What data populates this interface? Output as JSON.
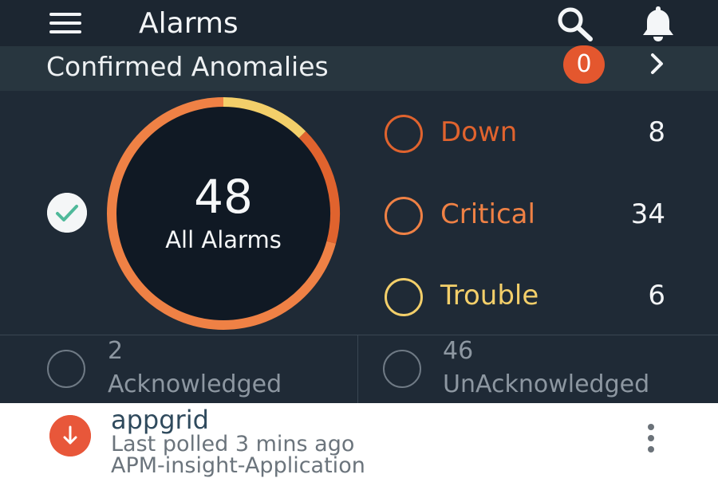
{
  "appbar": {
    "title": "Alarms",
    "menu_icon": "hamburger-menu-icon",
    "search_icon": "search-icon",
    "bell_icon": "bell-icon"
  },
  "anomalies": {
    "label": "Confirmed Anomalies",
    "count": "0",
    "chevron_icon": "chevron-right-icon"
  },
  "summary": {
    "total": "48",
    "total_label": "All Alarms",
    "selected_icon": "check-icon",
    "severities": [
      {
        "label": "Down",
        "count": "8",
        "color": "#e0632e"
      },
      {
        "label": "Critical",
        "count": "34",
        "color": "#ef8145"
      },
      {
        "label": "Trouble",
        "count": "6",
        "color": "#f3cf6a"
      }
    ]
  },
  "ack": {
    "acknowledged_count": "2",
    "acknowledged_label": "Acknowledged",
    "unacknowledged_count": "46",
    "unacknowledged_label": "UnAcknowledged"
  },
  "alarms": [
    {
      "name": "appgrid",
      "polled": "Last polled 3 mins ago",
      "type": "APM-insight-Application",
      "status_icon": "arrow-down-icon",
      "status_color": "#e8573a",
      "more_icon": "more-vertical-icon"
    }
  ],
  "colors": {
    "background": "#1f2a36",
    "appbar": "#1c2631",
    "anomalies_bar": "#28363f",
    "badge": "#e4572e"
  }
}
